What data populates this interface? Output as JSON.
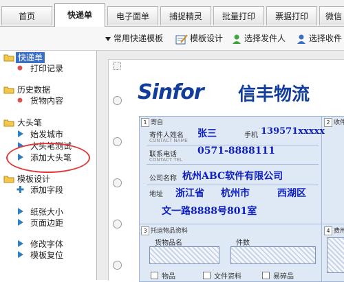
{
  "tabs": [
    {
      "label": "首页",
      "active": false
    },
    {
      "label": "快递单",
      "active": true
    },
    {
      "label": "电子面单",
      "active": false
    },
    {
      "label": "捕捉精灵",
      "active": false
    },
    {
      "label": "批量打印",
      "active": false
    },
    {
      "label": "票据打印",
      "active": false
    },
    {
      "label": "微信",
      "active": false
    }
  ],
  "toolbar": {
    "templates": "常用快递模板",
    "design": "模板设计",
    "sender": "选择发件人",
    "receiver": "选择收件"
  },
  "sidebar": {
    "groups": [
      {
        "label": "快递单",
        "items": [
          "打印记录"
        ]
      },
      {
        "label": "历史数据",
        "items": [
          "货物内容"
        ]
      },
      {
        "label": "大头笔",
        "items": [
          "始发城市",
          "大头笔测试",
          "添加大头笔"
        ]
      },
      {
        "label": "模板设计",
        "items": [
          "添加字段",
          "纸张大小",
          "页面边距",
          "修改字体",
          "模板复位"
        ]
      }
    ]
  },
  "waybill": {
    "brand_en": "Sinfor",
    "brand_cn": "信丰物流",
    "section1": "寄自",
    "section2": "收件",
    "section3": "托运物品资料",
    "section4": "费用",
    "sender_name_label": "寄件人姓名",
    "sender_name": "张三",
    "mobile_label": "手机",
    "mobile": "139571xxxxx",
    "phone_label": "联系电话",
    "phone": "0571-8888111",
    "company_label": "公司名称",
    "company": "杭州ABC软件有限公司",
    "address_label": "地址",
    "province": "浙江省",
    "city": "杭州市",
    "district": "西湖区",
    "street": "文一路8888号801室",
    "goods_label": "货物品名",
    "count_label": "件数",
    "items_label": "物品",
    "docs_label": "文件资料",
    "fragile_label": "易碎品",
    "small_labels": {
      "name": "CONTACT NAME",
      "phone": "CONTACT TEL"
    }
  },
  "colors": {
    "accent": "#3b6fc8",
    "brand": "#123d9c",
    "value": "#0c1ec2",
    "annotation": "#e03a3a"
  }
}
